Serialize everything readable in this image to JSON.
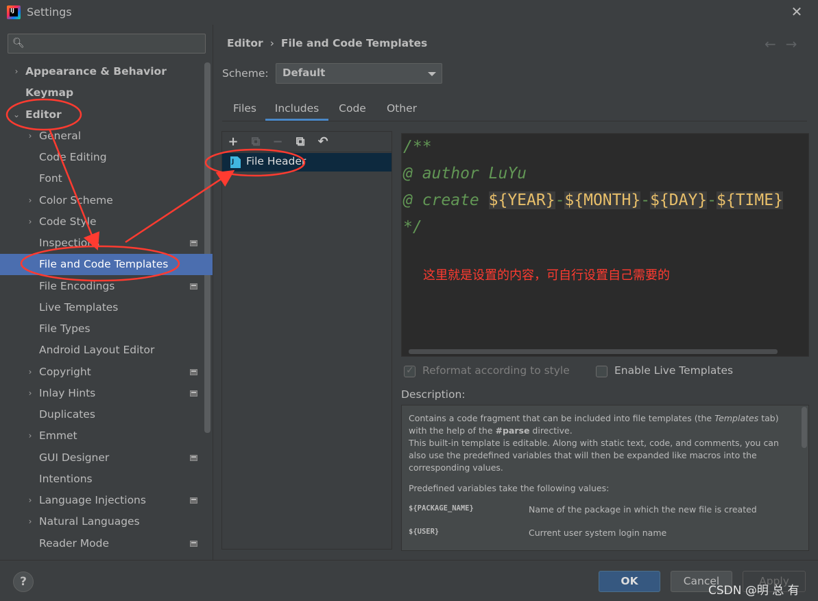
{
  "window": {
    "title": "Settings",
    "app_icon": "intellij-logo-icon",
    "close_icon": "close-icon"
  },
  "search": {
    "placeholder": "",
    "value": "",
    "icon": "search-icon"
  },
  "sidebar": {
    "items": [
      {
        "label": "Appearance & Behavior",
        "chevron": "›"
      },
      {
        "label": "Keymap"
      },
      {
        "label": "Editor",
        "chevron": "⌄"
      },
      {
        "label": "General",
        "chevron": "›"
      },
      {
        "label": "Code Editing"
      },
      {
        "label": "Font"
      },
      {
        "label": "Color Scheme",
        "chevron": "›"
      },
      {
        "label": "Code Style",
        "chevron": "›"
      },
      {
        "label": "Inspections"
      },
      {
        "label": "File and Code Templates"
      },
      {
        "label": "File Encodings"
      },
      {
        "label": "Live Templates"
      },
      {
        "label": "File Types"
      },
      {
        "label": "Android Layout Editor"
      },
      {
        "label": "Copyright",
        "chevron": "›"
      },
      {
        "label": "Inlay Hints",
        "chevron": "›"
      },
      {
        "label": "Duplicates"
      },
      {
        "label": "Emmet",
        "chevron": "›"
      },
      {
        "label": "GUI Designer"
      },
      {
        "label": "Intentions"
      },
      {
        "label": "Language Injections",
        "chevron": "›"
      },
      {
        "label": "Natural Languages",
        "chevron": "›"
      },
      {
        "label": "Reader Mode"
      }
    ]
  },
  "breadcrumb": {
    "parent": "Editor",
    "separator": "›",
    "current": "File and Code Templates"
  },
  "nav": {
    "back": "←",
    "forward": "→"
  },
  "scheme": {
    "label": "Scheme:",
    "value": "Default"
  },
  "tabs": [
    "Files",
    "Includes",
    "Code",
    "Other"
  ],
  "toolbar": {
    "add": "+",
    "copy_disabled": "⧉",
    "remove": "−",
    "copy": "⧉",
    "reset": "↶"
  },
  "templates": [
    {
      "name": "File Header",
      "icon": "java-file-icon"
    }
  ],
  "editor": {
    "line1": "/**",
    "line2": "@ author LuYu",
    "line3_prefix": "@ create ",
    "vars": [
      "${YEAR}",
      "${MONTH}",
      "${DAY}",
      "${TIME}"
    ],
    "dash": "-",
    "line4": "*/",
    "note": "这里就是设置的内容，可自行设置自己需要的"
  },
  "options": {
    "reformat": "Reformat according to style",
    "live_templates": "Enable Live Templates"
  },
  "description": {
    "label": "Description:",
    "p1_a": "Contains a code fragment that can be included into file templates (the ",
    "p1_em": "Templates",
    "p1_b": " tab) with the help of the ",
    "p1_code": "#parse",
    "p1_c": " directive.",
    "p1_d": "This built-in template is editable. Along with static text, code, and comments, you can also use the predefined variables that will then be expanded like macros into the corresponding values.",
    "p2": "Predefined variables take the following values:",
    "variables": [
      {
        "name": "${PACKAGE_NAME}",
        "desc": "Name of the package in which the new file is created"
      },
      {
        "name": "${USER}",
        "desc": "Current user system login name"
      }
    ]
  },
  "footer": {
    "help": "?",
    "ok": "OK",
    "cancel": "Cancel",
    "apply": "Apply",
    "watermark": "CSDN @明 总 有"
  },
  "colors": {
    "selection": "#4b6eaf",
    "annotation": "#ff3b30",
    "comment_green": "#629755",
    "variable": "#e8bf6a"
  }
}
